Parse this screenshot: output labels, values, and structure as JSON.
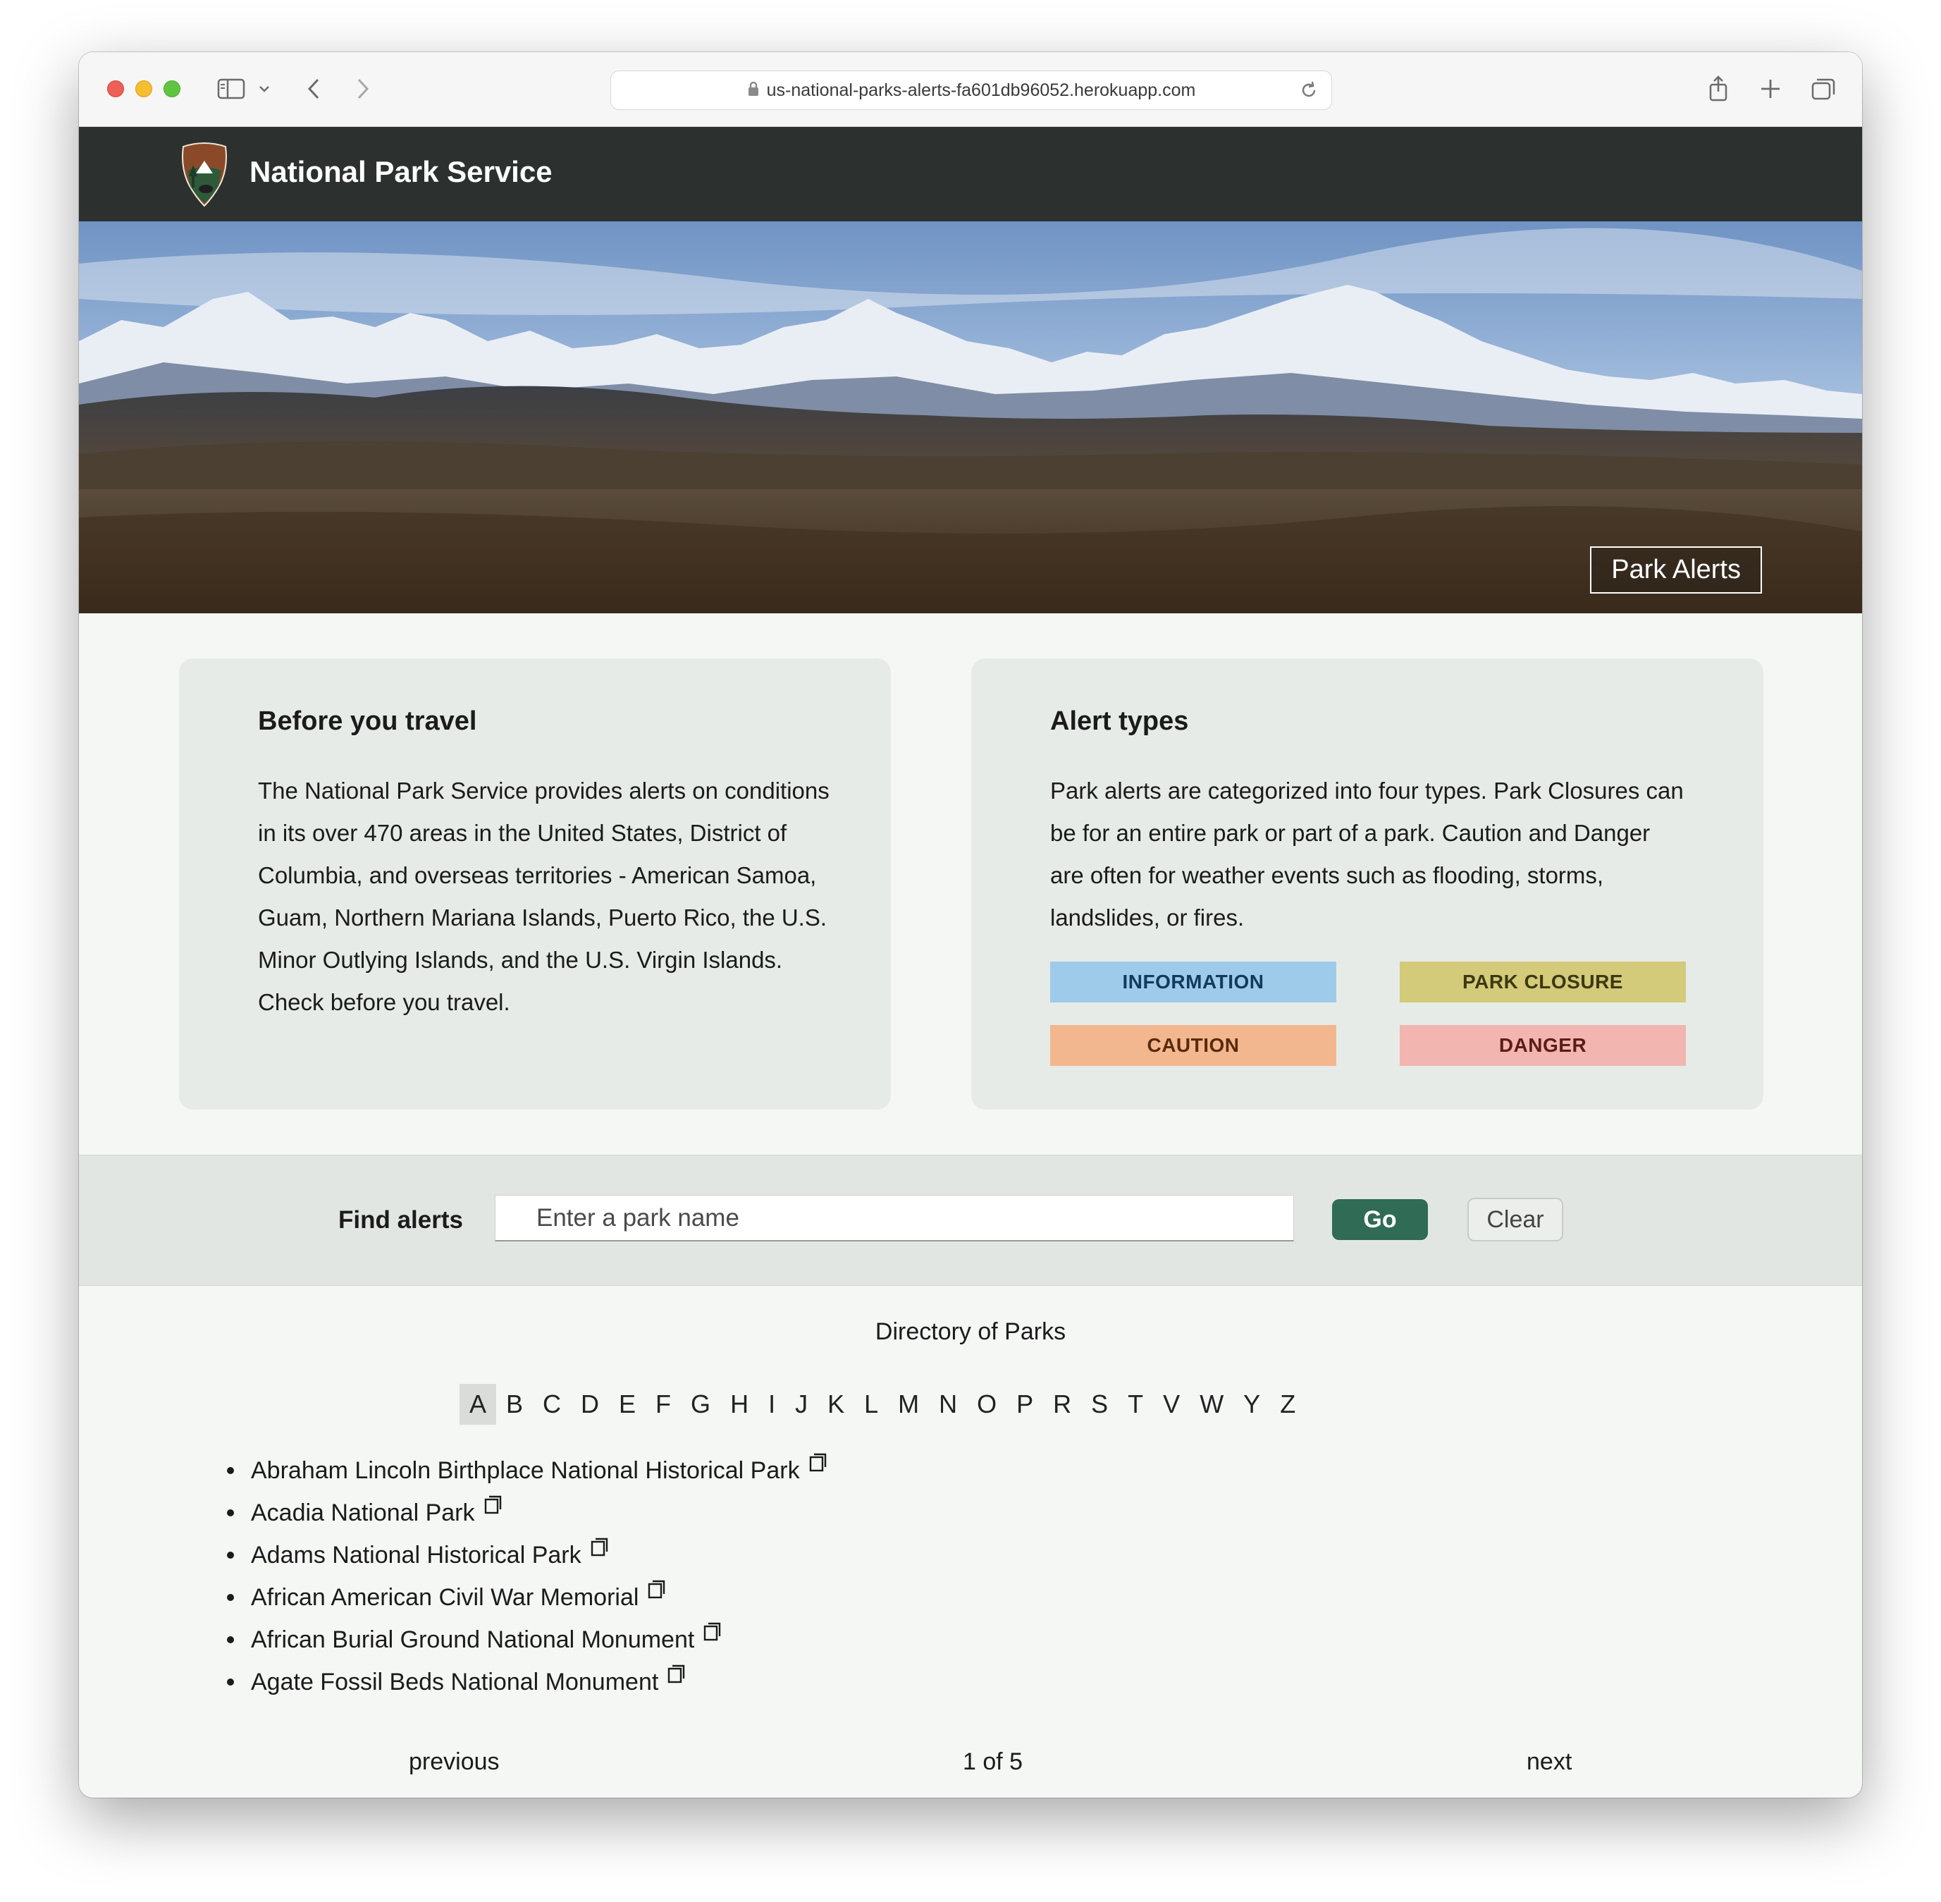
{
  "browser": {
    "url": "us-national-parks-alerts-fa601db96052.herokuapp.com"
  },
  "header": {
    "title": "National Park Service",
    "logo_text": "NATIONAL PARK SERVICE"
  },
  "hero": {
    "badge": "Park Alerts"
  },
  "before_travel": {
    "title": "Before you travel",
    "body": "The National Park Service provides alerts on conditions in its over 470 areas in the United States, District of Columbia, and overseas territories - American Samoa, Guam, Northern Mariana Islands, Puerto Rico, the U.S. Minor Outlying Islands, and the U.S. Virgin Islands. Check before you travel."
  },
  "alert_types": {
    "title": "Alert types",
    "body": "Park alerts are categorized into four types. Park Closures can be for an entire park or part of a park. Caution and Danger are often for weather events such as flooding, storms, landslides, or fires.",
    "types": [
      {
        "label": "INFORMATION",
        "color": "#9fcbeb"
      },
      {
        "label": "PARK CLOSURE",
        "color": "#d3ca7a"
      },
      {
        "label": "CAUTION",
        "color": "#f3b78f"
      },
      {
        "label": "DANGER",
        "color": "#f2b5b0"
      }
    ]
  },
  "search": {
    "label": "Find alerts",
    "placeholder": "Enter a park name",
    "go_label": "Go",
    "clear_label": "Clear"
  },
  "directory": {
    "title": "Directory of Parks",
    "letters": [
      "A",
      "B",
      "C",
      "D",
      "E",
      "F",
      "G",
      "H",
      "I",
      "J",
      "K",
      "L",
      "M",
      "N",
      "O",
      "P",
      "R",
      "S",
      "T",
      "V",
      "W",
      "Y",
      "Z"
    ],
    "active_letter": "A",
    "parks": [
      "Abraham Lincoln Birthplace National Historical Park",
      "Acadia National Park",
      "Adams National Historical Park",
      "African American Civil War Memorial",
      "African Burial Ground National Monument",
      "Agate Fossil Beds National Monument"
    ]
  },
  "pagination": {
    "previous": "previous",
    "count": "1 of 5",
    "next": "next"
  },
  "colors": {
    "header_bg": "#2c3130",
    "go_button": "#2f6b55",
    "page_bg": "#f4f7f4",
    "card_bg": "#e7ebe7"
  }
}
